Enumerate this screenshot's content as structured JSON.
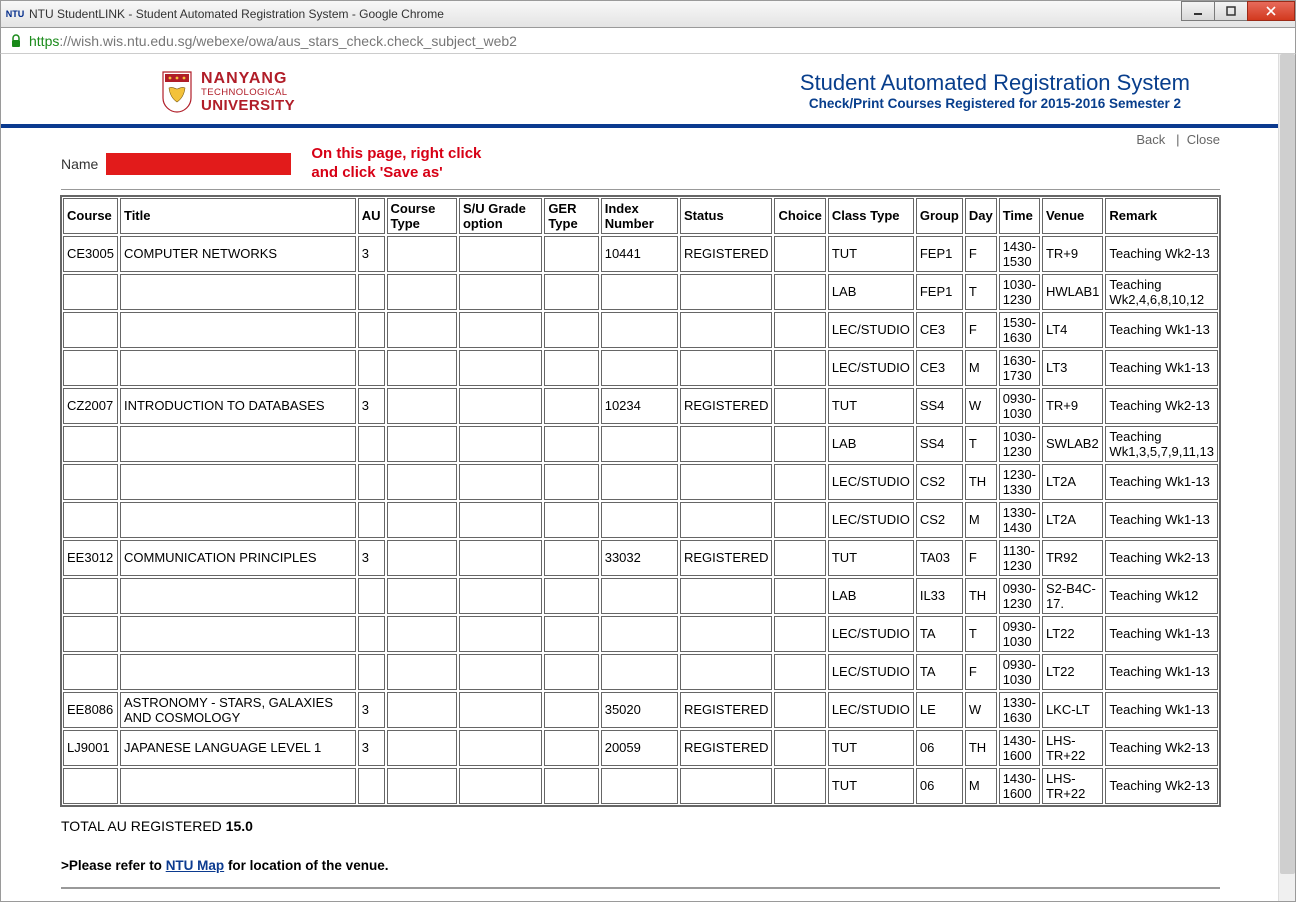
{
  "window": {
    "title": "NTU StudentLINK - Student Automated Registration System - Google Chrome",
    "url_scheme": "https",
    "url_rest": "://wish.wis.ntu.edu.sg/webexe/owa/aus_stars_check.check_subject_web2"
  },
  "logo": {
    "line1": "NANYANG",
    "line2": "TECHNOLOGICAL",
    "line3": "UNIVERSITY"
  },
  "header": {
    "title": "Student Automated Registration System",
    "subtitle": "Check/Print Courses Registered for 2015-2016 Semester 2"
  },
  "links": {
    "back": "Back",
    "sep": "|",
    "close": "Close"
  },
  "name_label": "Name",
  "instruction_line1": "On this page, right click",
  "instruction_line2": "and click 'Save as'",
  "columns": [
    "Course",
    "Title",
    "AU",
    "Course Type",
    "S/U Grade option",
    "GER Type",
    "Index Number",
    "Status",
    "Choice",
    "Class Type",
    "Group",
    "Day",
    "Time",
    "Venue",
    "Remark"
  ],
  "rows": [
    {
      "course": "CE3005",
      "title": "COMPUTER NETWORKS",
      "au": "3",
      "ctype": "",
      "su": "",
      "ger": "",
      "index": "10441",
      "status": "REGISTERED",
      "choice": "",
      "class": "TUT",
      "group": "FEP1",
      "day": "F",
      "time": "1430-1530",
      "venue": "TR+9",
      "remark": "Teaching Wk2-13"
    },
    {
      "course": "",
      "title": "",
      "au": "",
      "ctype": "",
      "su": "",
      "ger": "",
      "index": "",
      "status": "",
      "choice": "",
      "class": "LAB",
      "group": "FEP1",
      "day": "T",
      "time": "1030-1230",
      "venue": "HWLAB1",
      "remark": "Teaching Wk2,4,6,8,10,12"
    },
    {
      "course": "",
      "title": "",
      "au": "",
      "ctype": "",
      "su": "",
      "ger": "",
      "index": "",
      "status": "",
      "choice": "",
      "class": "LEC/STUDIO",
      "group": "CE3",
      "day": "F",
      "time": "1530-1630",
      "venue": "LT4",
      "remark": "Teaching Wk1-13"
    },
    {
      "course": "",
      "title": "",
      "au": "",
      "ctype": "",
      "su": "",
      "ger": "",
      "index": "",
      "status": "",
      "choice": "",
      "class": "LEC/STUDIO",
      "group": "CE3",
      "day": "M",
      "time": "1630-1730",
      "venue": "LT3",
      "remark": "Teaching Wk1-13"
    },
    {
      "course": "CZ2007",
      "title": "INTRODUCTION TO DATABASES",
      "au": "3",
      "ctype": "",
      "su": "",
      "ger": "",
      "index": "10234",
      "status": "REGISTERED",
      "choice": "",
      "class": "TUT",
      "group": "SS4",
      "day": "W",
      "time": "0930-1030",
      "venue": "TR+9",
      "remark": "Teaching Wk2-13"
    },
    {
      "course": "",
      "title": "",
      "au": "",
      "ctype": "",
      "su": "",
      "ger": "",
      "index": "",
      "status": "",
      "choice": "",
      "class": "LAB",
      "group": "SS4",
      "day": "T",
      "time": "1030-1230",
      "venue": "SWLAB2",
      "remark": "Teaching Wk1,3,5,7,9,11,13"
    },
    {
      "course": "",
      "title": "",
      "au": "",
      "ctype": "",
      "su": "",
      "ger": "",
      "index": "",
      "status": "",
      "choice": "",
      "class": "LEC/STUDIO",
      "group": "CS2",
      "day": "TH",
      "time": "1230-1330",
      "venue": "LT2A",
      "remark": "Teaching Wk1-13"
    },
    {
      "course": "",
      "title": "",
      "au": "",
      "ctype": "",
      "su": "",
      "ger": "",
      "index": "",
      "status": "",
      "choice": "",
      "class": "LEC/STUDIO",
      "group": "CS2",
      "day": "M",
      "time": "1330-1430",
      "venue": "LT2A",
      "remark": "Teaching Wk1-13"
    },
    {
      "course": "EE3012",
      "title": "COMMUNICATION PRINCIPLES",
      "au": "3",
      "ctype": "",
      "su": "",
      "ger": "",
      "index": "33032",
      "status": "REGISTERED",
      "choice": "",
      "class": "TUT",
      "group": "TA03",
      "day": "F",
      "time": "1130-1230",
      "venue": "TR92",
      "remark": "Teaching Wk2-13"
    },
    {
      "course": "",
      "title": "",
      "au": "",
      "ctype": "",
      "su": "",
      "ger": "",
      "index": "",
      "status": "",
      "choice": "",
      "class": "LAB",
      "group": "IL33",
      "day": "TH",
      "time": "0930-1230",
      "venue": "S2-B4C-17.",
      "remark": "Teaching Wk12"
    },
    {
      "course": "",
      "title": "",
      "au": "",
      "ctype": "",
      "su": "",
      "ger": "",
      "index": "",
      "status": "",
      "choice": "",
      "class": "LEC/STUDIO",
      "group": "TA",
      "day": "T",
      "time": "0930-1030",
      "venue": "LT22",
      "remark": "Teaching Wk1-13"
    },
    {
      "course": "",
      "title": "",
      "au": "",
      "ctype": "",
      "su": "",
      "ger": "",
      "index": "",
      "status": "",
      "choice": "",
      "class": "LEC/STUDIO",
      "group": "TA",
      "day": "F",
      "time": "0930-1030",
      "venue": "LT22",
      "remark": "Teaching Wk1-13"
    },
    {
      "course": "EE8086",
      "title": "ASTRONOMY - STARS, GALAXIES AND COSMOLOGY",
      "au": "3",
      "ctype": "",
      "su": "",
      "ger": "",
      "index": "35020",
      "status": "REGISTERED",
      "choice": "",
      "class": "LEC/STUDIO",
      "group": "LE",
      "day": "W",
      "time": "1330-1630",
      "venue": "LKC-LT",
      "remark": "Teaching Wk1-13"
    },
    {
      "course": "LJ9001",
      "title": "JAPANESE LANGUAGE LEVEL 1",
      "au": "3",
      "ctype": "",
      "su": "",
      "ger": "",
      "index": "20059",
      "status": "REGISTERED",
      "choice": "",
      "class": "TUT",
      "group": "06",
      "day": "TH",
      "time": "1430-1600",
      "venue": "LHS-TR+22",
      "remark": "Teaching Wk2-13"
    },
    {
      "course": "",
      "title": "",
      "au": "",
      "ctype": "",
      "su": "",
      "ger": "",
      "index": "",
      "status": "",
      "choice": "",
      "class": "TUT",
      "group": "06",
      "day": "M",
      "time": "1430-1600",
      "venue": "LHS-TR+22",
      "remark": "Teaching Wk2-13"
    }
  ],
  "total": {
    "label": "TOTAL AU REGISTERED ",
    "value": "15.0"
  },
  "footer": {
    "prefix": ">Please refer to ",
    "link": "NTU Map",
    "suffix": " for location of the venue."
  }
}
